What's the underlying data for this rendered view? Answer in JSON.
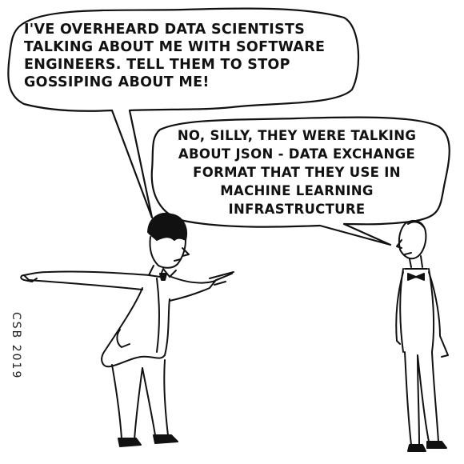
{
  "comic": {
    "speech_bubble_1": "I'VE OVERHEARD DATA SCIENTISTS\nTALKING ABOUT ME WITH SOFTWARE\nENGINEERS. TELL THEM TO STOP\nGOSSIPING ABOUT ME!",
    "speech_bubble_2": "NO, SILLY, THEY WERE TALKING\nABOUT JSON - DATA EXCHANGE\nFORMAT THAT THEY USE IN\nMACHINE LEARNING\nINFRASTRUCTURE",
    "signature": "CSB 2019"
  },
  "colors": {
    "ink": "#111111",
    "paper": "#ffffff"
  }
}
